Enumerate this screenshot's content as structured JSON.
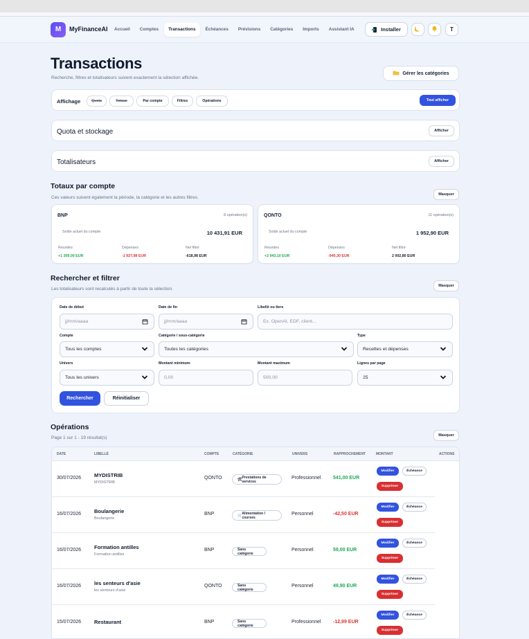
{
  "header": {
    "logo_letter": "M",
    "brand": "MyFinanceAI",
    "nav": [
      {
        "label": "Accueil"
      },
      {
        "label": "Comptes"
      },
      {
        "label": "Transactions"
      },
      {
        "label": "Échéances"
      },
      {
        "label": "Prévisions"
      },
      {
        "label": "Catégories"
      },
      {
        "label": "Imports"
      },
      {
        "label": "Assistant IA"
      }
    ],
    "install_label": "Installer",
    "theme_icon": "moon-icon",
    "notification_icon": "bell-icon",
    "avatar_letter": "T"
  },
  "page": {
    "title": "Transactions",
    "subtitle": "Recherche, filtres et totalisateurs suivent exactement la sélection affichée.",
    "manage_categories_label": "Gérer les catégories"
  },
  "display": {
    "label": "Affichage",
    "buttons": [
      {
        "label": "Quota",
        "active": false
      },
      {
        "label": "Totaux",
        "active": false
      },
      {
        "label": "Par compte",
        "active": true
      },
      {
        "label": "Filtres",
        "active": true
      },
      {
        "label": "Opérations",
        "active": true
      }
    ],
    "show_all_label": "Tout afficher"
  },
  "collapsed_sections": [
    {
      "title": "Quota et stockage",
      "button": "Afficher"
    },
    {
      "title": "Totalisateurs",
      "button": "Afficher"
    }
  ],
  "account_totals": {
    "title": "Totaux par compte",
    "subtitle": "Ces valeurs suivent également la période, la catégorie et les autres filtres.",
    "mask_label": "Masquer",
    "accounts": [
      {
        "name": "BNP",
        "operations": "8 opération(s)",
        "balance_label": "Solde actuel du compte",
        "balance": "10 431,91 EUR",
        "income_label": "Recettes",
        "income": "+1 309,00 EUR",
        "expenses_label": "Dépenses",
        "expenses": "-1 927,98 EUR",
        "net_label": "Net filtré",
        "net": "-618,98 EUR"
      },
      {
        "name": "QONTO",
        "operations": "11 opération(s)",
        "balance_label": "Solde actuel du compte",
        "balance": "1 952,90 EUR",
        "income_label": "Recettes",
        "income": "+2 943,10 EUR",
        "expenses_label": "Dépenses",
        "expenses": "-940,30 EUR",
        "net_label": "Net filtré",
        "net": "2 002,80 EUR"
      }
    ]
  },
  "search": {
    "title": "Rechercher et filtrer",
    "subtitle": "Les totalisateurs sont recalculés à partir de toute la sélection.",
    "mask_label": "Masquer",
    "fields": {
      "start_date_label": "Date de début",
      "start_date_placeholder": "jj/mm/aaaa",
      "end_date_label": "Date de fin",
      "end_date_placeholder": "jj/mm/aaaa",
      "label_label": "Libellé ou tiers",
      "label_placeholder": "Ex. OpenAI, EDF, client...",
      "account_label": "Compte",
      "account_value": "Tous les comptes",
      "category_label": "Catégorie / sous-catégorie",
      "category_value": "Toutes les catégories",
      "type_label": "Type",
      "type_value": "Recettes et dépenses",
      "universe_label": "Univers",
      "universe_value": "Tous les univers",
      "min_label": "Montant minimum",
      "min_placeholder": "0,00",
      "max_label": "Montant maximum",
      "max_placeholder": "500,00",
      "rows_label": "Lignes par page",
      "rows_value": "25"
    },
    "search_label": "Rechercher",
    "reset_label": "Réinitialiser"
  },
  "operations": {
    "title": "Opérations",
    "subtitle": "Page 1 sur 1 - 19 résultat(s)",
    "mask_label": "Masquer",
    "columns": {
      "date": "DATE",
      "label": "LIBELLÉ",
      "account": "COMPTE",
      "category": "CATÉGORIE",
      "universe": "UNIVERS",
      "reconciliation": "RAPPROCHEMENT",
      "amount": "MONTANT",
      "actions": "ACTIONS"
    },
    "actions": {
      "modify": "Modifier",
      "due": "Échéance",
      "delete": "Supprimer"
    },
    "rows": [
      {
        "date": "30/07/2026",
        "label": "MYDISTRIB",
        "sublabel": "MYDISTRIB",
        "account": "QONTO",
        "category_icon": "tools-icon",
        "category": "Prestations de services",
        "universe": "Professionnel",
        "amount": "541,00 EUR",
        "amount_color": "#20a957"
      },
      {
        "date": "16/07/2026",
        "label": "Boulangerie",
        "sublabel": "Boulangerie",
        "account": "BNP",
        "category_icon": "cart-icon",
        "category": "Alimentation / courses",
        "universe": "Personnel",
        "amount": "-42,50 EUR",
        "amount_color": "#df3434"
      },
      {
        "date": "16/07/2026",
        "label": "Formation antilles",
        "sublabel": "Formation antilles",
        "account": "BNP",
        "category_icon": "",
        "category": "Sans catégorie",
        "universe": "Personnel",
        "amount": "59,00 EUR",
        "amount_color": "#20a957"
      },
      {
        "date": "16/07/2026",
        "label": "les senteurs d'asie",
        "sublabel": "les senteurs d'asie",
        "account": "QONTO",
        "category_icon": "",
        "category": "Sans catégorie",
        "universe": "Personnel",
        "amount": "49,90 EUR",
        "amount_color": "#20a957"
      },
      {
        "date": "15/07/2026",
        "label": "Restaurant",
        "sublabel": "",
        "account": "BNP",
        "category_icon": "",
        "category": "Sans catégorie",
        "universe": "Professionnel",
        "amount": "-12,99 EUR",
        "amount_color": "#df3434"
      }
    ]
  }
}
